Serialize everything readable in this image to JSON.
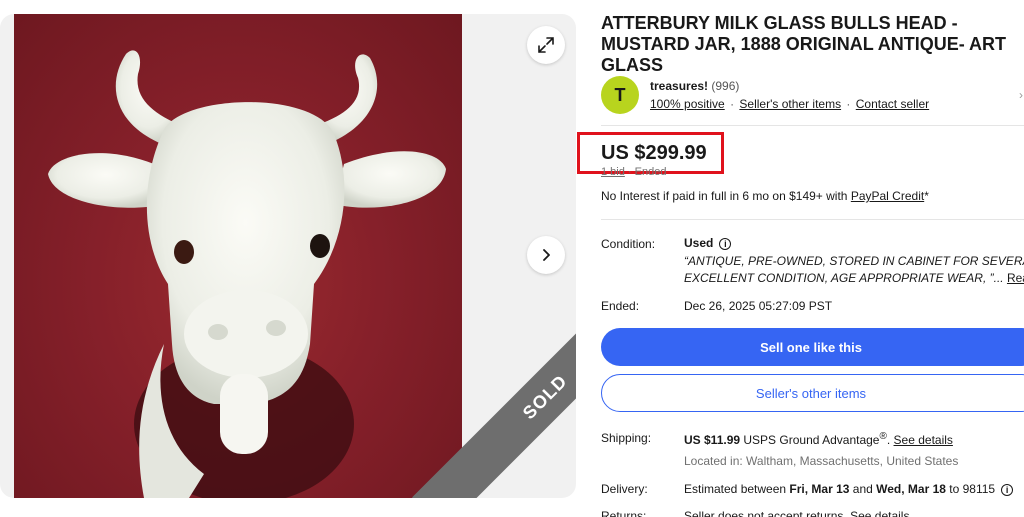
{
  "listing": {
    "title": "ATTERBURY MILK GLASS BULLS HEAD - MUSTARD JAR, 1888 ORIGINAL ANTIQUE- ART GLASS",
    "sold_ribbon": "SOLD"
  },
  "seller": {
    "avatar_letter": "T",
    "name": "treasures!",
    "feedback_count": "(996)",
    "positive": "100% positive",
    "other_items_link": "Seller's other items",
    "contact_link": "Contact seller",
    "separator": "·"
  },
  "price": {
    "amount": "US $299.99",
    "bids": "1 bid",
    "status": "· Ended"
  },
  "financing": {
    "text": "No Interest if paid in full in 6 mo on $149+ with",
    "link": "PayPal Credit",
    "suffix": "*"
  },
  "condition": {
    "label": "Condition:",
    "value": "Used",
    "info_icon": "i",
    "desc_line1": "“ANTIQUE, PRE-OWNED, STORED IN CABINET FOR SEVERAL YEAR",
    "desc_line2": "EXCELLENT CONDITION, AGE APPROPRIATE WEAR, ”...",
    "read_more": "Read more"
  },
  "ended": {
    "label": "Ended:",
    "value": "Dec 26, 2025 05:27:09 PST"
  },
  "actions": {
    "sell_one": "Sell one like this",
    "other_items": "Seller's other items"
  },
  "shipping": {
    "label": "Shipping:",
    "cost": "US $11.99",
    "service": " USPS Ground Advantage",
    "reg": "®",
    "dot": ". ",
    "details_link": "See details",
    "location": "Located in: Waltham, Massachusetts, United States"
  },
  "delivery": {
    "label": "Delivery:",
    "prefix": "Estimated between ",
    "date1": "Fri, Mar 13",
    "and": " and ",
    "date2": "Wed, Mar 18",
    "to": " to 98115",
    "info_icon": "i"
  },
  "returns": {
    "label": "Returns:",
    "value": "Seller does not accept returns. See details"
  },
  "icons": {
    "expand": "expand-icon",
    "next": "chevron-right-icon",
    "seller_chevron": "›"
  },
  "colors": {
    "accent": "#3665f3",
    "highlight": "#e0121c",
    "avatar": "#b8d41e",
    "ribbon": "#6e6e6e"
  }
}
